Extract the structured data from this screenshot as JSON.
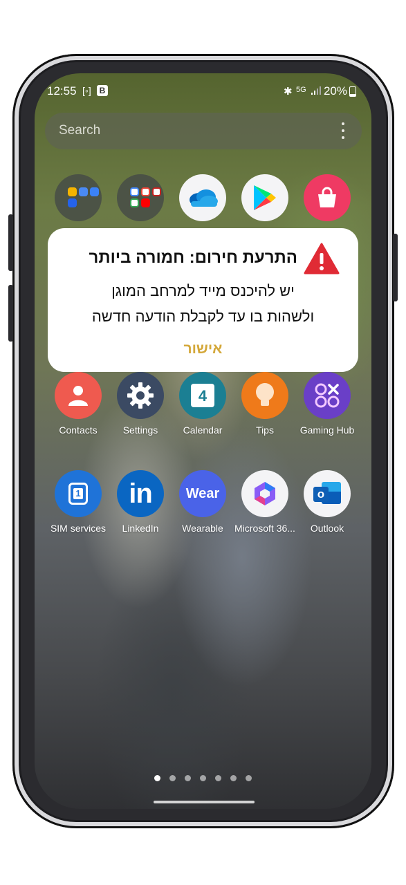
{
  "status_bar": {
    "time": "12:55",
    "icons": [
      "screenshot-icon",
      "b-badge-icon",
      "bluetooth-icon",
      "5g-icon",
      "signal-icon"
    ],
    "b_badge": "B",
    "network": "5G",
    "battery_percent": "20%"
  },
  "search": {
    "placeholder": "Search"
  },
  "top_row_apps": [
    {
      "label": "",
      "icon": "folder-icon"
    },
    {
      "label": "",
      "icon": "google-folder-icon"
    },
    {
      "label": "",
      "icon": "onedrive-icon"
    },
    {
      "label": "",
      "icon": "play-store-icon"
    },
    {
      "label": "",
      "icon": "galaxy-store-icon"
    }
  ],
  "alert": {
    "title": "התרעת חירום: חמורה ביותר",
    "body_line1": "יש להיכנס מייד למרחב המוגן",
    "body_line2": "ולשהות בו עד לקבלת הודעה חדשה",
    "confirm": "אישור",
    "accent_color": "#d4a83a",
    "warning_color": "#e02b35"
  },
  "apps_row2": [
    {
      "label": "Contacts",
      "icon": "contacts-icon",
      "color": "#ef5a4f"
    },
    {
      "label": "Settings",
      "icon": "gear-icon",
      "color": "#3b4a63"
    },
    {
      "label": "Calendar",
      "icon": "calendar-icon",
      "color": "#1b7f93",
      "day": "4"
    },
    {
      "label": "Tips",
      "icon": "lightbulb-icon",
      "color": "#ef7a1a"
    },
    {
      "label": "Gaming Hub",
      "icon": "gaming-hub-icon",
      "color": "#6a3fc7"
    }
  ],
  "apps_row3": [
    {
      "label": "SIM services",
      "icon": "sim-icon",
      "color": "#1f73d8",
      "digit": "1"
    },
    {
      "label": "LinkedIn",
      "icon": "linkedin-icon",
      "color": "#0a66c2",
      "text": "in"
    },
    {
      "label": "Wearable",
      "icon": "wear-icon",
      "color": "#4a63e8",
      "text": "Wear"
    },
    {
      "label": "Microsoft 36...",
      "icon": "microsoft-365-icon",
      "color": "#f4f4f6"
    },
    {
      "label": "Outlook",
      "icon": "outlook-icon",
      "color": "#f4f4f6",
      "letter": "o"
    }
  ],
  "page_indicator": {
    "total": 7,
    "active": 1
  }
}
